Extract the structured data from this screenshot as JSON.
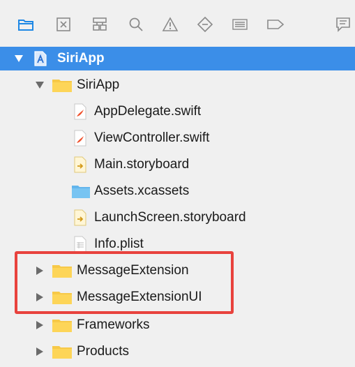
{
  "toolbar": {
    "buttons": [
      {
        "icon": "folder-icon",
        "active": true
      },
      {
        "icon": "source-control-icon"
      },
      {
        "icon": "hierarchy-icon"
      },
      {
        "icon": "search-icon"
      },
      {
        "icon": "warning-icon"
      },
      {
        "icon": "test-diamond-icon"
      },
      {
        "icon": "debug-list-icon"
      },
      {
        "icon": "breakpoint-icon"
      },
      {
        "icon": "report-icon"
      }
    ],
    "accent": "#1e88e5"
  },
  "navigator": {
    "project": {
      "label": "SiriApp",
      "expanded": true
    },
    "items": [
      {
        "label": "SiriApp",
        "type": "group",
        "expanded": true
      },
      {
        "label": "AppDelegate.swift",
        "type": "swift"
      },
      {
        "label": "ViewController.swift",
        "type": "swift"
      },
      {
        "label": "Main.storyboard",
        "type": "storyboard"
      },
      {
        "label": "Assets.xcassets",
        "type": "assets"
      },
      {
        "label": "LaunchScreen.storyboard",
        "type": "storyboard"
      },
      {
        "label": "Info.plist",
        "type": "plist"
      },
      {
        "label": "MessageExtension",
        "type": "group",
        "expanded": false,
        "highlighted": true
      },
      {
        "label": "MessageExtensionUI",
        "type": "group",
        "expanded": false,
        "highlighted": true
      },
      {
        "label": "Frameworks",
        "type": "group",
        "expanded": false
      },
      {
        "label": "Products",
        "type": "group",
        "expanded": false
      }
    ],
    "selection_color": "#3b8ee8",
    "highlight_color": "#e8423d"
  }
}
